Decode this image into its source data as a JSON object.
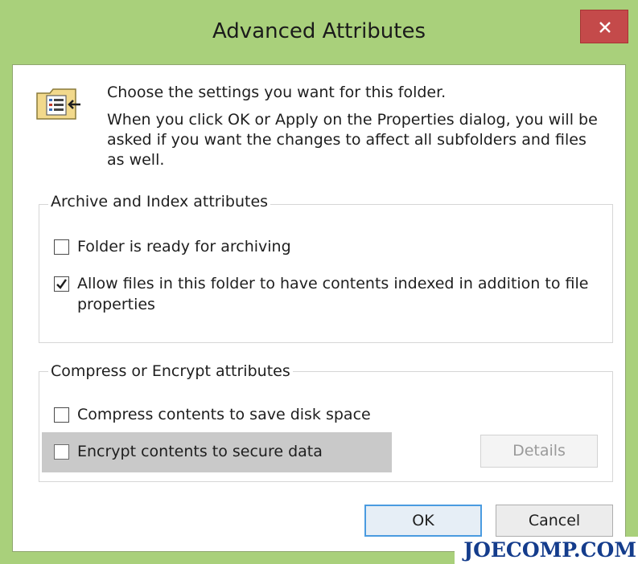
{
  "window": {
    "title": "Advanced Attributes",
    "close_icon": "close-x-icon"
  },
  "intro": {
    "icon": "folder-properties-icon",
    "line1": "Choose the settings you want for this folder.",
    "line2": "When you click OK or Apply on the Properties dialog, you will be asked if you want the changes to affect all subfolders and files as well."
  },
  "archive_group": {
    "title": "Archive and Index attributes",
    "items": [
      {
        "label": "Folder is ready for archiving",
        "checked": false
      },
      {
        "label": "Allow files in this folder to have contents indexed in addition to file properties",
        "checked": true
      }
    ]
  },
  "compress_group": {
    "title": "Compress or Encrypt attributes",
    "items": [
      {
        "label": "Compress contents to save disk space",
        "checked": false
      },
      {
        "label": "Encrypt contents to secure data",
        "checked": false
      }
    ],
    "details_label": "Details"
  },
  "buttons": {
    "ok": "OK",
    "cancel": "Cancel"
  },
  "watermark": "JOECOMP.COM",
  "colors": {
    "frame": "#a9d07b",
    "close": "#c44a4a",
    "default_button_border": "#4a9be0"
  }
}
